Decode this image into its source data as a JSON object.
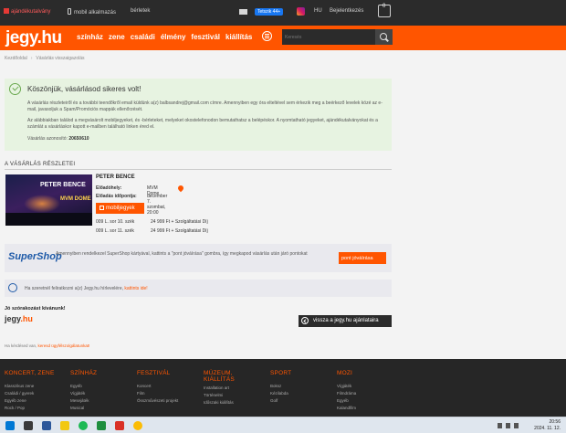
{
  "topbar": {
    "gift": "ajándékutalvány",
    "mobile": "mobil alkalmazás",
    "rental": "bérletek",
    "facebook": "Tetszik 44+",
    "lang": "HU",
    "login": "Bejelentkezés",
    "cart_count": "0"
  },
  "header": {
    "logo_main": "jegy",
    "logo_suffix": ".hu",
    "nav": [
      "színház",
      "zene",
      "családi",
      "élmény",
      "fesztivál",
      "kiállítás"
    ],
    "search_placeholder": "Keresés"
  },
  "breadcrumb": [
    "Kezdőoldal",
    "Vásárlás visszaigazolás"
  ],
  "success": {
    "title": "Köszönjük, vásárlásod sikeres volt!",
    "p1": "A vásárlás részleteiről és a további teendőkről email küldünk a(z) balbsandrej@gmail.com címre. Amennyiben egy óra elteltével sem érkezik meg a beérkező levelek közé az e-mail, javasoljuk a Spam/Promóciós mappák ellenőrzését.",
    "p2": "Az alábbiakban találod a megvásárolt mobiljegyeket, és -bérleteket, melyeket okostelefonodon bemutathatsz a belépéskor. A nyomtatható jegyeket, ajándékutalványokat és a számlát a vásárláskor kapott e-mailben található linken éred el.",
    "order_label": "Vásárlás azonosító:",
    "order_id": "20650610"
  },
  "details": {
    "title": "A VÁSÁRLÁS RÉSZLETEI",
    "event_name": "PETER BENCE",
    "poster_name": "PETER BENCE",
    "poster_venue": "MVM DOME",
    "venue_label": "Előadóhely:",
    "venue_value": "MVM Dome",
    "date_label": "Előadás időpontja:",
    "date_value": "december 7. szombat, 20:00",
    "mobile_button": "mobiljegyek",
    "tickets": [
      {
        "seat": "009 L. sor 10. szék",
        "price": "24 999 Ft + Szolgáltatási Díj"
      },
      {
        "seat": "009 L. sor 11. szék",
        "price": "24 999 Ft + Szolgáltatási Díj"
      }
    ]
  },
  "supershop": {
    "logo": "SuperShop",
    "text": "Amennyiben rendelkezel SuperShop kártyával, kattints a \"pont jóváírása\" gombra, így megkapod vásárlás után járó pontokat",
    "button": "pont jóváírása"
  },
  "feedback": {
    "text": "Ha szeretnél feliratkozni a(z) Jegy.hu hírlevelére,",
    "link": "kattints ide!"
  },
  "goodbye": "Jó szórakozást kívánunk!",
  "small_logo": {
    "main": "jegy",
    "suffix": ".hu"
  },
  "back_button": "vissza a jegy.hu ajánlataira",
  "complaint": {
    "text": "Ha kérdésed van,",
    "link": "keresd ügyfélszolgálatunkat!"
  },
  "footer": [
    {
      "heading": "KONCERT, ZENE",
      "links": [
        "Klasszikus zene",
        "Családi / gyerek",
        "Egyéb zene",
        "Rock / Pop"
      ]
    },
    {
      "heading": "SZÍNHÁZ",
      "links": [
        "Egyéb",
        "Vígjáték",
        "Mesejáték",
        "Musical"
      ]
    },
    {
      "heading": "FESZTIVÁL",
      "links": [
        "Koncert",
        "Film",
        "Összművészeti projekt"
      ]
    },
    {
      "heading": "MÚZEUM, KIÁLLÍTÁS",
      "links": [
        "Installation art",
        "Történelmi",
        "Időszaki kiállítás"
      ]
    },
    {
      "heading": "SPORT",
      "links": [
        "Boksz",
        "Kézilabda",
        "Golf"
      ]
    },
    {
      "heading": "MOZI",
      "links": [
        "Vígjáték",
        "Filmdráma",
        "Egyéb",
        "Kalandfilm"
      ]
    }
  ],
  "taskbar": {
    "time": "20:56",
    "date": "2024. 11. 12."
  },
  "colors": {
    "brand": "#ff5500",
    "dark": "#2b2b2b",
    "success_bg": "#e7f3e1"
  }
}
